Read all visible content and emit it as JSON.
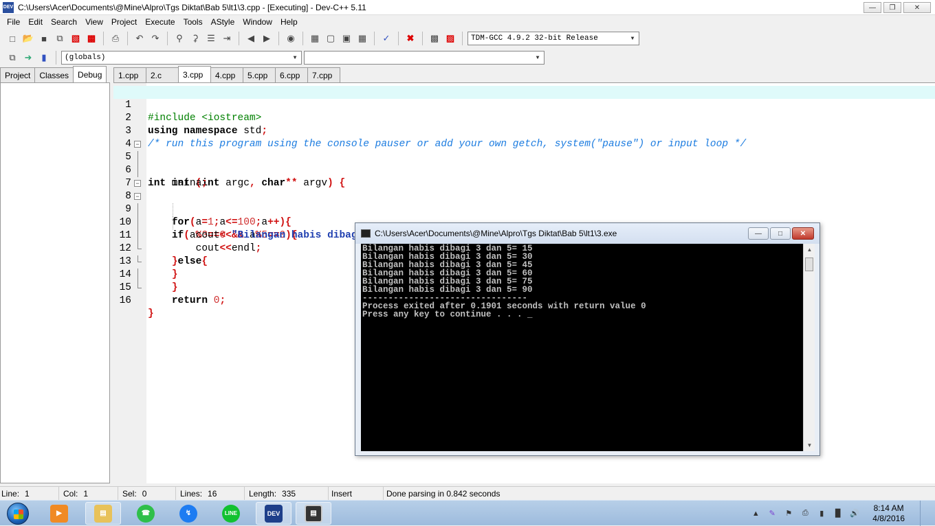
{
  "window": {
    "title": "C:\\Users\\Acer\\Documents\\@Mine\\Alpro\\Tgs Diktat\\Bab 5\\lt1\\3.cpp - [Executing] - Dev-C++ 5.11",
    "app_icon_text": "DEV"
  },
  "menu": [
    "File",
    "Edit",
    "Search",
    "View",
    "Project",
    "Execute",
    "Tools",
    "AStyle",
    "Window",
    "Help"
  ],
  "toolbar": {
    "compiler": "TDM-GCC 4.9.2 32-bit Release",
    "scope": "(globals)",
    "member": ""
  },
  "left_tabs": [
    "Project",
    "Classes",
    "Debug"
  ],
  "file_tabs": [
    "1.cpp",
    "2.c",
    "3.cpp",
    "4.cpp",
    "5.cpp",
    "6.cpp",
    "7.cpp"
  ],
  "active_file_tab": "3.cpp",
  "code": {
    "l1": "#include <iostream>",
    "l2a": "using namespace",
    "l2b": " std",
    "l2c": ";",
    "l3": "/* run this program using the console pauser or add your own getch, system(\"pause\") or input loop */",
    "l5a": "int",
    "l5b": " main",
    "l5c": "(",
    "l5d": "int",
    "l5e": " argc",
    "l5f": ",",
    "l5g": " char",
    "l5h": "**",
    "l5i": " argv",
    "l5j": ")",
    "l5k": " {",
    "l6a": "int",
    "l6b": " a",
    "l6c": ";",
    "l8a": "for",
    "l8b": "(",
    "l8c": "a",
    "l8d": "=",
    "l8e": "1",
    "l8f": ";",
    "l8g": "a",
    "l8h": "<=",
    "l8i": "100",
    "l8j": ";",
    "l8k": "a",
    "l8l": "++",
    "l8m": "){",
    "l9a": "if",
    "l9b": "(",
    "l9c": "a",
    "l9d": "%",
    "l9e": "3",
    "l9f": "==",
    "l9g": "0",
    "l9h": " && ",
    "l9i": "a",
    "l9j": "%",
    "l9k": "5",
    "l9l": "==",
    "l9m": "0",
    "l9n": "){",
    "l10a": "cout",
    "l10b": "<<",
    "l10c": "\"Bilangan habis dibagi 3 dan 5= \"",
    "l10d": "<<",
    "l10e": "a",
    "l10f": ";",
    "l11a": "cout",
    "l11b": "<<",
    "l11c": "endl",
    "l11d": ";",
    "l12a": "}",
    "l12b": "else",
    "l12c": "{",
    "l13": "}",
    "l14": "}",
    "l15a": "return",
    "l15b": " 0",
    "l15c": ";",
    "l16": "}"
  },
  "console": {
    "title": "C:\\Users\\Acer\\Documents\\@Mine\\Alpro\\Tgs Diktat\\Bab 5\\lt1\\3.exe",
    "lines": [
      "Bilangan habis dibagi 3 dan 5= 15",
      "Bilangan habis dibagi 3 dan 5= 30",
      "Bilangan habis dibagi 3 dan 5= 45",
      "Bilangan habis dibagi 3 dan 5= 60",
      "Bilangan habis dibagi 3 dan 5= 75",
      "Bilangan habis dibagi 3 dan 5= 90",
      "",
      "--------------------------------",
      "Process exited after 0.1901 seconds with return value 0",
      "Press any key to continue . . . _"
    ]
  },
  "status": {
    "line_label": "Line:",
    "line_val": "1",
    "col_label": "Col:",
    "col_val": "1",
    "sel_label": "Sel:",
    "sel_val": "0",
    "lines_label": "Lines:",
    "lines_val": "16",
    "length_label": "Length:",
    "length_val": "335",
    "mode": "Insert",
    "message": "Done parsing in 0.842 seconds"
  },
  "taskbar": {
    "time": "8:14 AM",
    "date": "4/8/2016",
    "dev_label": "DEV"
  }
}
